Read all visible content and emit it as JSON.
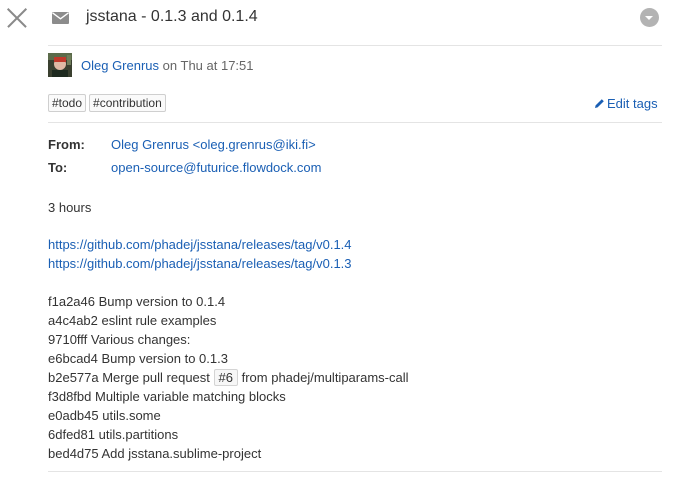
{
  "header": {
    "title": "jsstana - 0.1.3 and 0.1.4"
  },
  "meta": {
    "author": "Oleg Grenrus",
    "time": "on Thu at 17:51"
  },
  "tags": [
    "#todo",
    "#contribution"
  ],
  "edit_tags_label": "Edit tags",
  "headers": {
    "from_label": "From:",
    "from_value": "Oleg Grenrus <oleg.grenrus@iki.fi>",
    "to_label": "To:",
    "to_value": "open-source@futurice.flowdock.com"
  },
  "body": {
    "duration": "3 hours",
    "links": [
      "https://github.com/phadej/jsstana/releases/tag/v0.1.4",
      "https://github.com/phadej/jsstana/releases/tag/v0.1.3"
    ],
    "commits": [
      "f1a2a46 Bump version to 0.1.4",
      "a4c4ab2 eslint rule examples",
      "9710fff Various changes:",
      "e6bcad4 Bump version to 0.1.3",
      "b2e577a Merge pull request",
      "f3d8fbd Multiple variable matching blocks",
      "e0adb45 utils.some",
      "6dfed81 utils.partitions",
      "bed4d75 Add jsstana.sublime-project"
    ],
    "pr_badge": "#6",
    "pr_suffix": "from phadej/multiparams-call"
  }
}
